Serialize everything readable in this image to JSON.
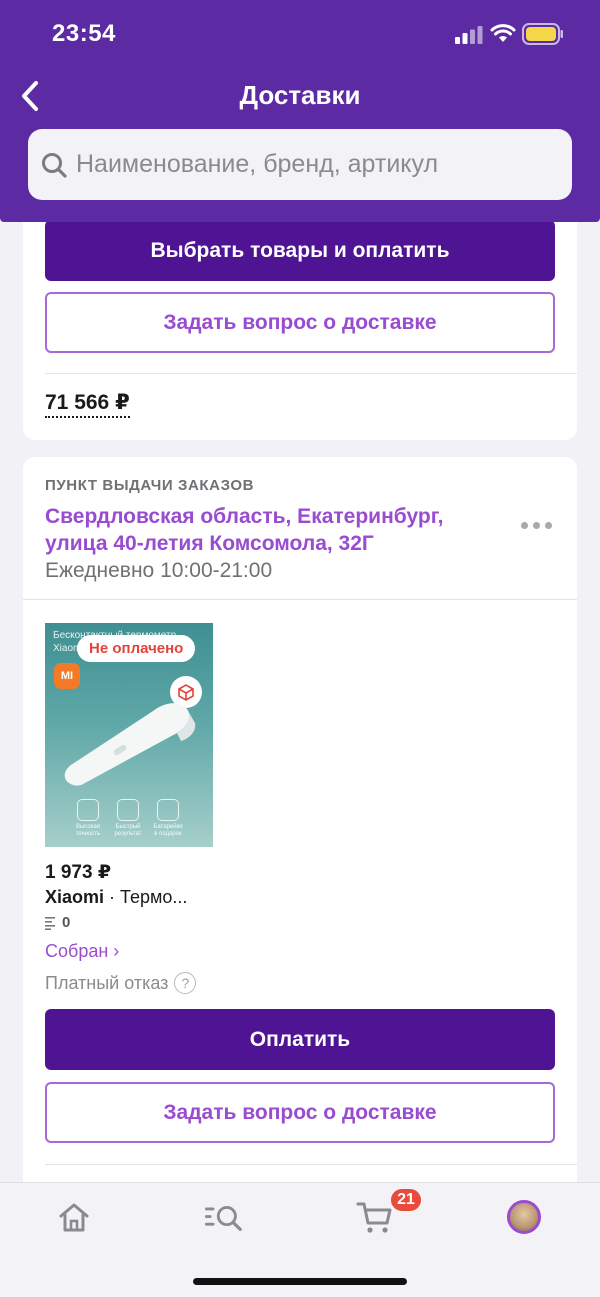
{
  "status_bar": {
    "time": "23:54"
  },
  "header": {
    "title": "Доставки",
    "search_placeholder": "Наименование, бренд, артикул"
  },
  "delivery_1": {
    "pay_button": "Выбрать товары и оплатить",
    "question_button": "Задать вопрос о доставке",
    "total": "71 566 ₽"
  },
  "delivery_2": {
    "pickup_label": "ПУНКТ ВЫДАЧИ ЗАКАЗОВ",
    "address": "Свердловская область, Екатеринбург, улица 40-летия Комсомола, 32Г",
    "hours": "Ежедневно 10:00-21:00",
    "product": {
      "image_text": "Бесконтактный термометр\nXiaomi",
      "badge": "Не оплачено",
      "brand_logo": "MI",
      "features": [
        "Высокая точность",
        "Быстрый результат",
        "Батарейки в подарок"
      ],
      "price": "1 973 ₽",
      "brand": "Xiaomi",
      "name": " · Термо...",
      "reviews": "0",
      "status": "Собран ›",
      "refusal": "Платный отказ"
    },
    "pay_button": "Оплатить",
    "question_button": "Задать вопрос о доставке"
  },
  "bottom_nav": {
    "items": [
      "home-icon",
      "catalog-search-icon",
      "cart-icon",
      "profile-avatar"
    ],
    "cart_count": "21"
  }
}
